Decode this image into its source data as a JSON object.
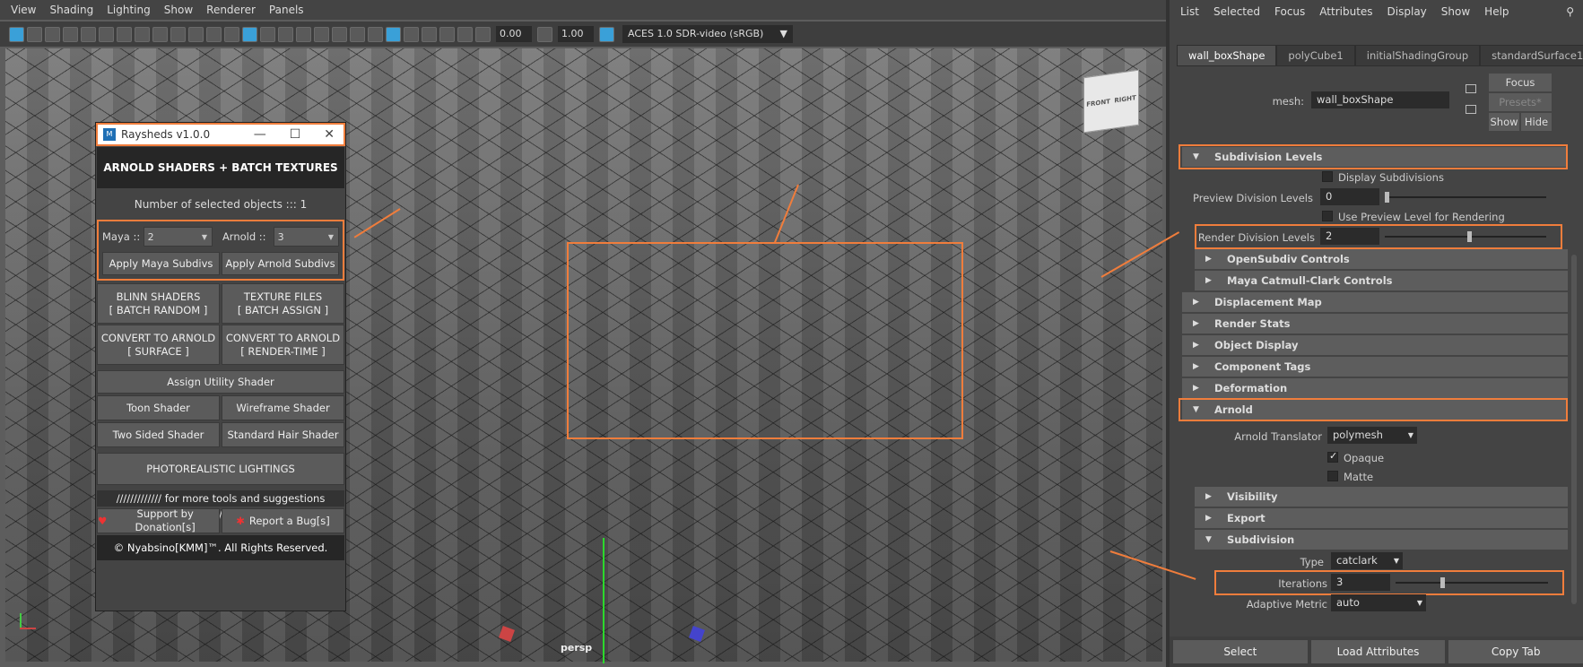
{
  "viewport": {
    "menu": [
      "View",
      "Shading",
      "Lighting",
      "Show",
      "Renderer",
      "Panels"
    ],
    "exposure": "0.00",
    "gamma": "1.00",
    "color_space": "ACES 1.0 SDR-video (sRGB)",
    "camera_label": "persp",
    "viewcube": {
      "front": "FRONT",
      "right": "RIGHT"
    }
  },
  "raysheds": {
    "title": "Raysheds v1.0.0",
    "logo": "M",
    "header": "ARNOLD SHADERS + BATCH TEXTURES",
    "selected_info": "Number of selected objects ::: 1",
    "maya_label": "Maya ::",
    "maya_value": "2",
    "arnold_label": "Arnold ::",
    "arnold_value": "3",
    "apply_maya": "Apply Maya Subdivs",
    "apply_arnold": "Apply Arnold Subdivs",
    "blinn": [
      "BLINN SHADERS",
      "[ BATCH RANDOM ]"
    ],
    "texture": [
      "TEXTURE FILES",
      "[ BATCH ASSIGN ]"
    ],
    "convert_surface": [
      "CONVERT TO ARNOLD",
      "[ SURFACE ]"
    ],
    "convert_render": [
      "CONVERT TO ARNOLD",
      "[ RENDER-TIME ]"
    ],
    "utility": "Assign Utility Shader",
    "toon": "Toon Shader",
    "wireframe": "Wireframe Shader",
    "twosided": "Two Sided Shader",
    "hair": "Standard Hair Shader",
    "photoreal": "PHOTOREALISTIC LIGHTINGS",
    "banner": "///////////// for more tools and suggestions /////////////",
    "donate": "Support by Donation[s]",
    "bug": "Report a Bug[s]",
    "footer": "© Nyabsino[KMM]™. All Rights Reserved."
  },
  "attr": {
    "menu": [
      "List",
      "Selected",
      "Focus",
      "Attributes",
      "Display",
      "Show",
      "Help"
    ],
    "tabs": [
      "wall_boxShape",
      "polyCube1",
      "initialShadingGroup",
      "standardSurface1"
    ],
    "mesh_label": "mesh:",
    "mesh_value": "wall_boxShape",
    "focus": "Focus",
    "presets": "Presets*",
    "show": "Show",
    "hide": "Hide",
    "subdiv_levels": "Subdivision Levels",
    "display_subdivs": "Display Subdivisions",
    "preview_label": "Preview Division Levels",
    "preview_value": "0",
    "use_preview": "Use Preview Level for Rendering",
    "render_label": "Render Division Levels",
    "render_value": "2",
    "opensubdiv": "OpenSubdiv Controls",
    "catmull": "Maya Catmull-Clark Controls",
    "displacement": "Displacement Map",
    "render_stats": "Render Stats",
    "object_display": "Object Display",
    "component_tags": "Component Tags",
    "deformation": "Deformation",
    "arnold": "Arnold",
    "translator_label": "Arnold Translator",
    "translator_value": "polymesh",
    "opaque": "Opaque",
    "matte": "Matte",
    "visibility": "Visibility",
    "export": "Export",
    "subdivision": "Subdivision",
    "type_label": "Type",
    "type_value": "catclark",
    "iter_label": "Iterations",
    "iter_value": "3",
    "adaptive_label": "Adaptive Metric",
    "adaptive_value": "auto",
    "select": "Select",
    "load": "Load Attributes",
    "copy": "Copy Tab"
  },
  "colors": {
    "highlight": "#f07d3c"
  }
}
